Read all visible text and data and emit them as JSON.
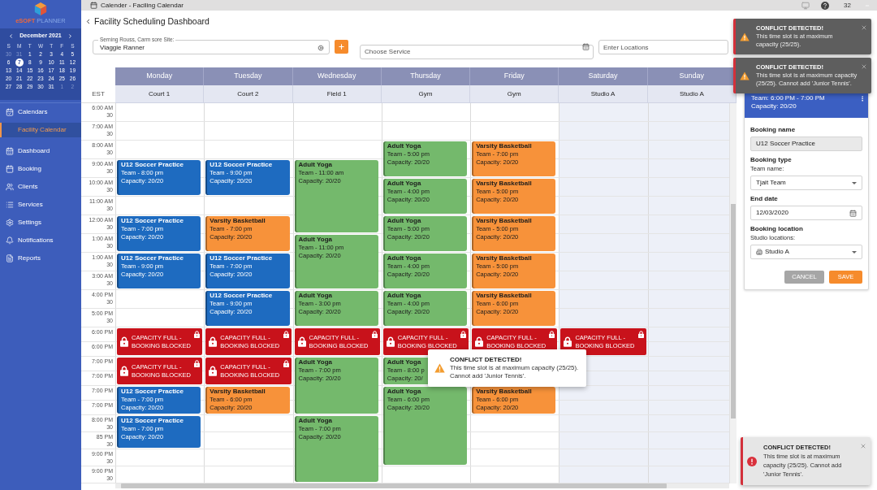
{
  "top_bar": {
    "title": "Calender - Faciling Calendar",
    "count": "32"
  },
  "sidebar": {
    "logo": {
      "brand": "eSOFT",
      "product": "PLANNER"
    },
    "mini_calendar": {
      "month": "December 2021",
      "weekdays": [
        "S",
        "M",
        "T",
        "W",
        "T",
        "F",
        "S"
      ],
      "weeks": [
        [
          {
            "day": "30",
            "in_month": false,
            "selected": false
          },
          {
            "day": "31",
            "in_month": false,
            "selected": false
          },
          {
            "day": "1",
            "in_month": true,
            "selected": false
          },
          {
            "day": "2",
            "in_month": true,
            "selected": false
          },
          {
            "day": "3",
            "in_month": true,
            "selected": false
          },
          {
            "day": "4",
            "in_month": true,
            "selected": false
          },
          {
            "day": "5",
            "in_month": true,
            "selected": false
          }
        ],
        [
          {
            "day": "6",
            "in_month": true,
            "selected": false
          },
          {
            "day": "7",
            "in_month": true,
            "selected": true
          },
          {
            "day": "8",
            "in_month": true,
            "selected": false
          },
          {
            "day": "9",
            "in_month": true,
            "selected": false
          },
          {
            "day": "10",
            "in_month": true,
            "selected": false
          },
          {
            "day": "11",
            "in_month": true,
            "selected": false
          },
          {
            "day": "12",
            "in_month": true,
            "selected": false
          }
        ],
        [
          {
            "day": "13",
            "in_month": true,
            "selected": false
          },
          {
            "day": "14",
            "in_month": true,
            "selected": false
          },
          {
            "day": "15",
            "in_month": true,
            "selected": false
          },
          {
            "day": "16",
            "in_month": true,
            "selected": false
          },
          {
            "day": "17",
            "in_month": true,
            "selected": false
          },
          {
            "day": "18",
            "in_month": true,
            "selected": false
          },
          {
            "day": "19",
            "in_month": true,
            "selected": false
          }
        ],
        [
          {
            "day": "20",
            "in_month": true,
            "selected": false
          },
          {
            "day": "21",
            "in_month": true,
            "selected": false
          },
          {
            "day": "22",
            "in_month": true,
            "selected": false
          },
          {
            "day": "23",
            "in_month": true,
            "selected": false
          },
          {
            "day": "24",
            "in_month": true,
            "selected": false
          },
          {
            "day": "25",
            "in_month": true,
            "selected": false
          },
          {
            "day": "26",
            "in_month": true,
            "selected": false
          }
        ],
        [
          {
            "day": "27",
            "in_month": true,
            "selected": false
          },
          {
            "day": "28",
            "in_month": true,
            "selected": false
          },
          {
            "day": "29",
            "in_month": true,
            "selected": false
          },
          {
            "day": "30",
            "in_month": true,
            "selected": false
          },
          {
            "day": "31",
            "in_month": true,
            "selected": false
          },
          {
            "day": "1",
            "in_month": false,
            "selected": false
          },
          {
            "day": "2",
            "in_month": false,
            "selected": false
          }
        ]
      ]
    },
    "nav": [
      {
        "label": "Calendars",
        "kind": "item",
        "selected": false
      },
      {
        "label": "Facility Calendar",
        "kind": "subitem",
        "selected": true
      },
      {
        "label": "Dashboard",
        "kind": "item",
        "selected": false
      },
      {
        "label": "Booking",
        "kind": "item",
        "selected": false
      },
      {
        "label": "Clients",
        "kind": "item",
        "selected": false
      },
      {
        "label": "Services",
        "kind": "item",
        "selected": false
      },
      {
        "label": "Settings",
        "kind": "item",
        "selected": false
      },
      {
        "label": "Notifications",
        "kind": "item",
        "selected": false
      },
      {
        "label": "Reports",
        "kind": "item",
        "selected": false
      }
    ]
  },
  "header": {
    "title": "Facility Scheduling Dashboard"
  },
  "filters": {
    "site": {
      "label": "Serning Rouss, Carm sore Site:",
      "value": "Viaggie Ranner"
    },
    "service": {
      "placeholder": "Choose Service"
    },
    "location": {
      "placeholder": "Enter Locations"
    }
  },
  "calendar": {
    "timezone": "EST",
    "time_rows": [
      {
        "label": "6:00 AM",
        "half": "30"
      },
      {
        "label": "7:00 AM",
        "half": "30"
      },
      {
        "label": "8:00 AM",
        "half": "30"
      },
      {
        "label": "9:00 AM",
        "half": "30"
      },
      {
        "label": "10:00 AM",
        "half": "30"
      },
      {
        "label": "11:00 AM",
        "half": "30"
      },
      {
        "label": "12:00 AM",
        "half": "30"
      },
      {
        "label": "1:00 AM",
        "half": "30"
      },
      {
        "label": "1:00 AM",
        "half": "30"
      },
      {
        "label": "3:00 AM",
        "half": "30"
      },
      {
        "label": "4:00 PM",
        "half": "30"
      },
      {
        "label": "5:00 PM",
        "half": "30"
      },
      {
        "label": "6:00 PM"
      },
      {
        "label": "6:00 PM"
      },
      {
        "label": "7:00 PM"
      },
      {
        "label": "7:00 PM"
      },
      {
        "label": "7:00 PM"
      },
      {
        "label": "7:00 PM"
      },
      {
        "label": "8:00 PM",
        "half": "30"
      },
      {
        "label": "85 PM",
        "half": "30"
      },
      {
        "label": "9:00 PM",
        "half": "30"
      },
      {
        "label": "9:00 PM",
        "half": "30"
      }
    ],
    "columns": [
      {
        "day": "Monday",
        "resource": "Court 1",
        "weekend": false,
        "events": [
          {
            "kind": "booking",
            "title": "U12 Soccer Practice",
            "team": "Team - 8:00 pm",
            "capacity": "Capacity: 20/20",
            "color": "#1e6bc0"
          },
          {
            "kind": "booking",
            "title": "U12 Soccer Practice",
            "team": "Team - 7:00 pm",
            "capacity": "Capacity: 20/20",
            "color": "#1e6bc0"
          },
          {
            "kind": "booking",
            "title": "U12 Soccer Practice",
            "team": "Team - 9:00 pm",
            "capacity": "Capacity: 20/20",
            "color": "#1e6bc0"
          },
          {
            "kind": "blocked",
            "text": "CAPACITY FULL - BOOKING BLOCKED"
          },
          {
            "kind": "blocked",
            "text": "CAPACITY FULL - BOOKING BLOCKED"
          },
          {
            "kind": "booking",
            "title": "U12 Soccer Practice",
            "team": "Team - 7:00 pm",
            "capacity": "Capacity: 20/20",
            "color": "#1e6bc0"
          },
          {
            "kind": "booking",
            "title": "U12 Soccer Practice",
            "team": "Team - 7:00 pm",
            "capacity": "Capacity: 20/20",
            "color": "#1e6bc0"
          }
        ]
      },
      {
        "day": "Tuesday",
        "resource": "Court 2",
        "weekend": false,
        "events": [
          {
            "kind": "booking",
            "title": "U12 Soccer Practice",
            "team": "Team - 9:00 pm",
            "capacity": "Capacity: 20/20",
            "color": "#1e6bc0"
          },
          {
            "kind": "booking",
            "title": "Varsity Basketball",
            "team": "Team - 7:00 pm",
            "capacity": "Capacity: 20/20",
            "color": "#f7923a"
          },
          {
            "kind": "booking",
            "title": "U12 Soccer Practice",
            "team": "Team - 7:00 pm",
            "capacity": "Capacity: 20/20",
            "color": "#1e6bc0"
          },
          {
            "kind": "booking",
            "title": "U12 Soccer Practice",
            "team": "Team - 9:00 pm",
            "capacity": "Capacity: 20/20",
            "color": "#1e6bc0"
          },
          {
            "kind": "blocked",
            "text": "CAPACITY FULL - BOOKING BLOCKED"
          },
          {
            "kind": "blocked",
            "text": "CAPACITY FULL - BOOKING BLOCKED"
          },
          {
            "kind": "booking",
            "title": "Varsity Basketball",
            "team": "Team - 6:00 pm",
            "capacity": "Capacity: 20/20",
            "color": "#f7923a"
          }
        ]
      },
      {
        "day": "Wednesday",
        "resource": "Field 1",
        "weekend": false,
        "events": [
          {
            "kind": "booking",
            "title": "Adult Yoga",
            "team": "Team - 11:00 am",
            "capacity": "Capacity: 20/20",
            "color": "#74b96c"
          },
          {
            "kind": "booking",
            "title": "Adult Yoga",
            "team": "Team - 11:00 pm",
            "capacity": "Capacity: 20/20",
            "color": "#74b96c"
          },
          {
            "kind": "booking",
            "title": "Adult Yoga",
            "team": "Team - 3:00 pm",
            "capacity": "Capacity: 20/20",
            "color": "#74b96c"
          },
          {
            "kind": "blocked",
            "text": "CAPACITY FULL - BOOKING BLOCKED"
          },
          {
            "kind": "booking",
            "title": "Adult Yoga",
            "team": "Team - 7:00 pm",
            "capacity": "Capacity: 20/20",
            "color": "#74b96c"
          },
          {
            "kind": "booking",
            "title": "Adult Yoga",
            "team": "Team - 7:00 pm",
            "capacity": "Capacity: 20/20",
            "color": "#74b96c"
          }
        ]
      },
      {
        "day": "Thursday",
        "resource": "Gym",
        "weekend": false,
        "events": [
          {
            "kind": "booking",
            "title": "Adult Yoga",
            "team": "Team - 5:00 pm",
            "capacity": "Capacity: 20/20",
            "color": "#74b96c"
          },
          {
            "kind": "booking",
            "title": "Adult Yoga",
            "team": "Team - 4:00 pm",
            "capacity": "Capacity: 20/20",
            "color": "#74b96c"
          },
          {
            "kind": "booking",
            "title": "Adult Yoga",
            "team": "Team - 5:00 pm",
            "capacity": "Capacity: 20/20",
            "color": "#74b96c"
          },
          {
            "kind": "booking",
            "title": "Adult Yoga",
            "team": "Team - 4:00 pm",
            "capacity": "Capacity: 20/20",
            "color": "#74b96c"
          },
          {
            "kind": "booking",
            "title": "Adult Yoga",
            "team": "Team - 4:00 pm",
            "capacity": "Capacity: 20/20",
            "color": "#74b96c"
          },
          {
            "kind": "blocked",
            "text": "CAPACITY FULL - BOOKING BLOCKED"
          },
          {
            "kind": "booking",
            "title": "Adult Yoga",
            "team": "Team - 8:00 p",
            "capacity": "Capacity: 20/",
            "color": "#74b96c"
          },
          {
            "kind": "booking",
            "title": "Adult Yoga",
            "team": "Team - 6:00 pm",
            "capacity": "Capacity: 20/20",
            "color": "#74b96c"
          }
        ]
      },
      {
        "day": "Friday",
        "resource": "Gym",
        "weekend": false,
        "events": [
          {
            "kind": "booking",
            "title": "Varsity Basketball",
            "team": "Team - 7:00 pm",
            "capacity": "Capacity: 20/20",
            "color": "#f7923a"
          },
          {
            "kind": "booking",
            "title": "Varsity Basketball",
            "team": "Team - 5:00 pm",
            "capacity": "Capacity: 20/20",
            "color": "#f7923a"
          },
          {
            "kind": "booking",
            "title": "Varsity Basketball",
            "team": "Team - 5:00 pm",
            "capacity": "Capacity: 20/20",
            "color": "#f7923a"
          },
          {
            "kind": "booking",
            "title": "Varsity Basketball",
            "team": "Team - 5:00 pm",
            "capacity": "Capacity: 20/20",
            "color": "#f7923a"
          },
          {
            "kind": "booking",
            "title": "Varsity Basketball",
            "team": "Team - 6:00 pm",
            "capacity": "Capacity: 20/20",
            "color": "#f7923a"
          },
          {
            "kind": "blocked",
            "text": "CAPACITY FULL - BOOKING BLOCKED"
          },
          {
            "kind": "booking",
            "title": "Varsity Basketball",
            "team": "Team - 6:00 pm",
            "capacity": "Capacity: 20/20",
            "color": "#f7923a"
          }
        ]
      },
      {
        "day": "Saturday",
        "resource": "Studio A",
        "weekend": true,
        "events": [
          {
            "kind": "blocked",
            "text": "CAPACITY FULL - BOOKING BLOCKED"
          }
        ]
      },
      {
        "day": "Sunday",
        "resource": "Studio A",
        "weekend": true
      }
    ]
  },
  "popover": {
    "title": "CONFLICT DETECTED!",
    "message": "This time slot is at maximum capacity (25/25). Cannot add 'Junior Tennis'."
  },
  "booking_panel": {
    "summary": [
      "Team: 6:00 PM - 7:00 PM",
      "Capacity: 20/20"
    ],
    "fields": [
      {
        "kind": "text",
        "heading": "Booking name",
        "value": "U12 Soccer Practice",
        "disabled": true
      },
      {
        "kind": "select",
        "heading": "Booking type",
        "label": "Team name:",
        "value": "Tjait Team",
        "disabled": false
      },
      {
        "kind": "date",
        "heading": "End date",
        "value": "12/03/2020",
        "disabled": false
      },
      {
        "kind": "location",
        "heading": "Booking location",
        "label": "Studio locations:",
        "value": "Studio A",
        "disabled": false
      }
    ],
    "cancel": "CANCEL",
    "save": "SAVE"
  },
  "toasts": [
    {
      "kind": "warning",
      "title": "CONFLICT DETECTED!",
      "message": "This time slot is at maximum capacity (25/25)."
    },
    {
      "kind": "warning",
      "title": "CONFLICT DETECTED!",
      "message": "This time slot is at maximum capacity (25/25). Cannot add 'Junior Tennis'."
    },
    {
      "kind": "error",
      "title": "CONFLICT DETECTED!",
      "message": "This time slot is at maximum capacity (25/25). Cannot add 'Junior Tennis'."
    }
  ]
}
